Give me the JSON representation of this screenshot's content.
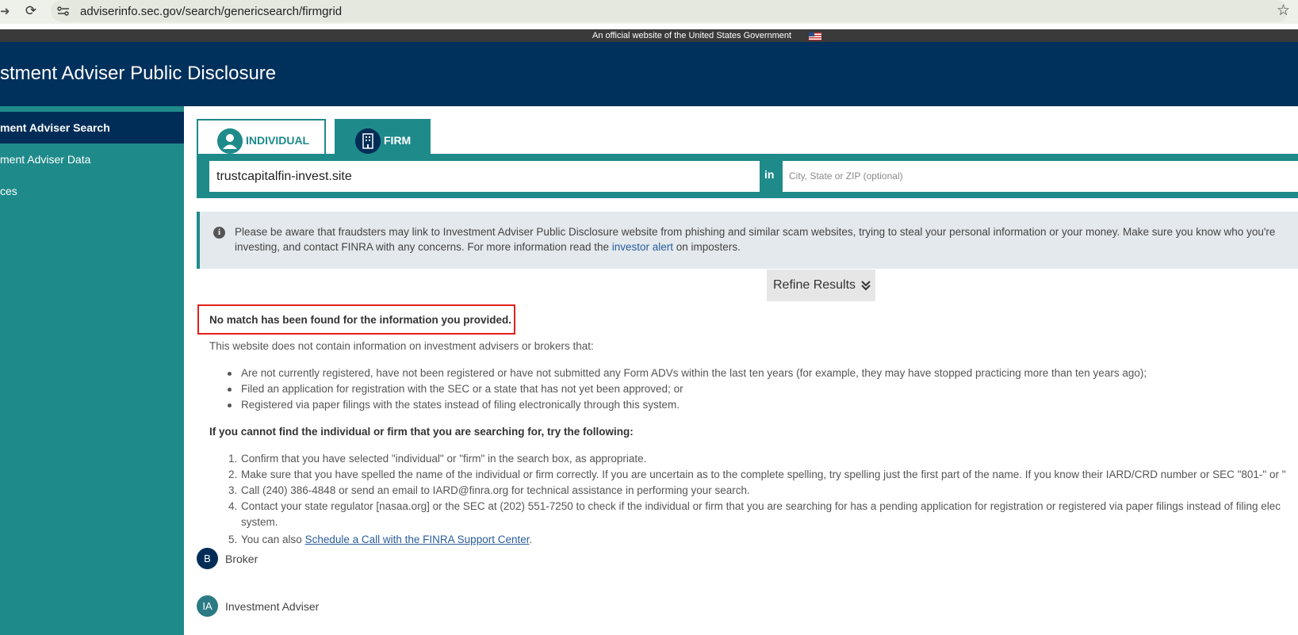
{
  "browser": {
    "url": "adviserinfo.sec.gov/search/genericsearch/firmgrid",
    "back_icon": "arrow-right-icon",
    "reload_icon": "reload-icon",
    "bookmark_icon": "star-icon"
  },
  "gov_banner": {
    "text": "An official website of the United States Government"
  },
  "header": {
    "title": "stment Adviser Public Disclosure"
  },
  "sidebar": {
    "items": [
      {
        "label": "ment Adviser Search",
        "active": true
      },
      {
        "label": "ment Adviser Data",
        "active": false
      },
      {
        "label": "ces",
        "active": false
      }
    ]
  },
  "tabs": [
    {
      "label": "INDIVIDUAL",
      "icon": "person-icon"
    },
    {
      "label": "FIRM",
      "icon": "building-icon"
    }
  ],
  "search": {
    "query": "trustcapitalfin-invest.site",
    "in_label": "in",
    "location_placeholder": "City, State or ZIP (optional)"
  },
  "alert": {
    "line1": "Please be aware that fraudsters may link to Investment Adviser Public Disclosure website from phishing and similar scam websites, trying to steal your personal information or your money. Make sure you know who you're",
    "line2_before": "investing, and contact FINRA with any concerns. For more information read the ",
    "line2_link": "investor alert",
    "line2_after": " on imposters."
  },
  "refine": {
    "label": "Refine Results"
  },
  "results": {
    "no_match": "No match has been found for the information you provided.",
    "intro": "This website does not contain information on investment advisers or brokers that:",
    "bullets": [
      "Are not currently registered, have not been registered or have not submitted any Form ADVs within the last ten years (for example, they may have stopped practicing more than ten years ago);",
      "Filed an application for registration with the SEC or a state that has not yet been approved; or",
      "Registered via paper filings with the states instead of filing electronically through this system."
    ],
    "try_heading": "If you cannot find the individual or firm that you are searching for, try the following:",
    "steps": [
      "Confirm that you have selected \"individual\" or \"firm\" in the search box, as appropriate.",
      "Make sure that you have spelled the name of the individual or firm correctly. If you are uncertain as to the complete spelling, try spelling just the first part of the name. If you know their IARD/CRD number or SEC \"801-\" or \"",
      "Call (240) 386-4848 or send an email to IARD@finra.org for technical assistance in performing your search.",
      "Contact your state regulator [nasaa.org] or the SEC at (202) 551-7250 to check if the individual or firm that you are searching for has a pending application for registration or registered via paper filings instead of filing elec"
    ],
    "step4_cont": "system.",
    "step5_before": "You can also ",
    "step5_link": "Schedule a Call with the FINRA Support Center",
    "step5_after": "."
  },
  "legend": [
    {
      "badge": "B",
      "label": "Broker",
      "color": "#002d57"
    },
    {
      "badge": "IA",
      "label": "Investment Adviser",
      "color": "#2b7a85"
    }
  ]
}
